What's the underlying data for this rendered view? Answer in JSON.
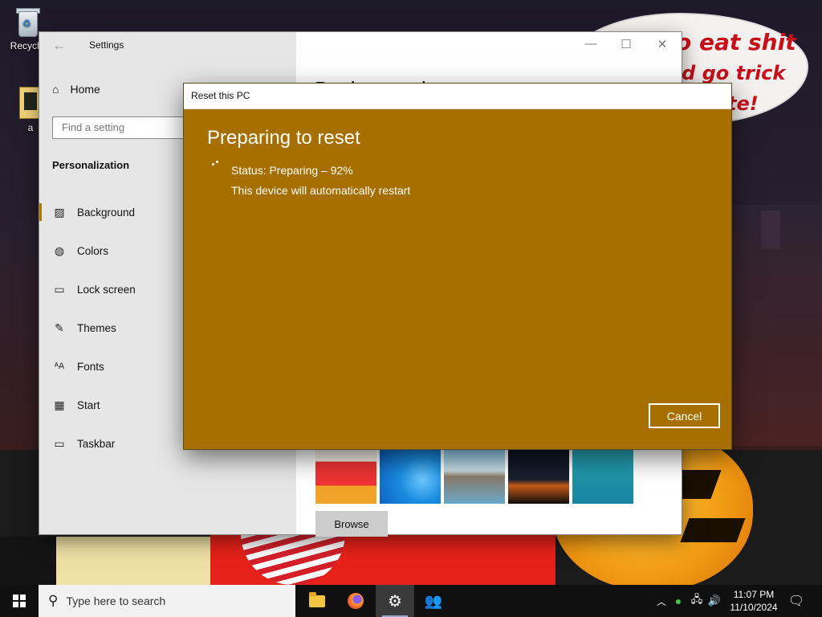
{
  "desktop": {
    "recycle_bin_label": "Recycle",
    "file_label": "a",
    "wallpaper_text": [
      "o eat shit",
      "nd go trick",
      "te!"
    ]
  },
  "settings": {
    "window_title": "Settings",
    "nav_home": "Home",
    "search_placeholder": "Find a setting",
    "section_label": "Personalization",
    "page_heading": "Background",
    "nav_items": [
      {
        "label": "Background",
        "icon": "picture-icon"
      },
      {
        "label": "Colors",
        "icon": "palette-icon"
      },
      {
        "label": "Lock screen",
        "icon": "lock-screen-icon"
      },
      {
        "label": "Themes",
        "icon": "themes-icon"
      },
      {
        "label": "Fonts",
        "icon": "fonts-icon"
      },
      {
        "label": "Start",
        "icon": "start-icon"
      },
      {
        "label": "Taskbar",
        "icon": "taskbar-icon"
      }
    ],
    "browse_label": "Browse"
  },
  "reset_dialog": {
    "title": "Reset this PC",
    "heading": "Preparing to reset",
    "status": "Status: Preparing – 92%",
    "progress_percent": 92,
    "restart_notice": "This device will automatically restart",
    "cancel_label": "Cancel",
    "accent_color": "#a76f00"
  },
  "taskbar": {
    "search_placeholder": "Type here to search",
    "time": "11:07 PM",
    "date": "11/10/2024",
    "apps": [
      "file-explorer-icon",
      "firefox-icon",
      "settings-gear-icon",
      "people-icon"
    ]
  }
}
